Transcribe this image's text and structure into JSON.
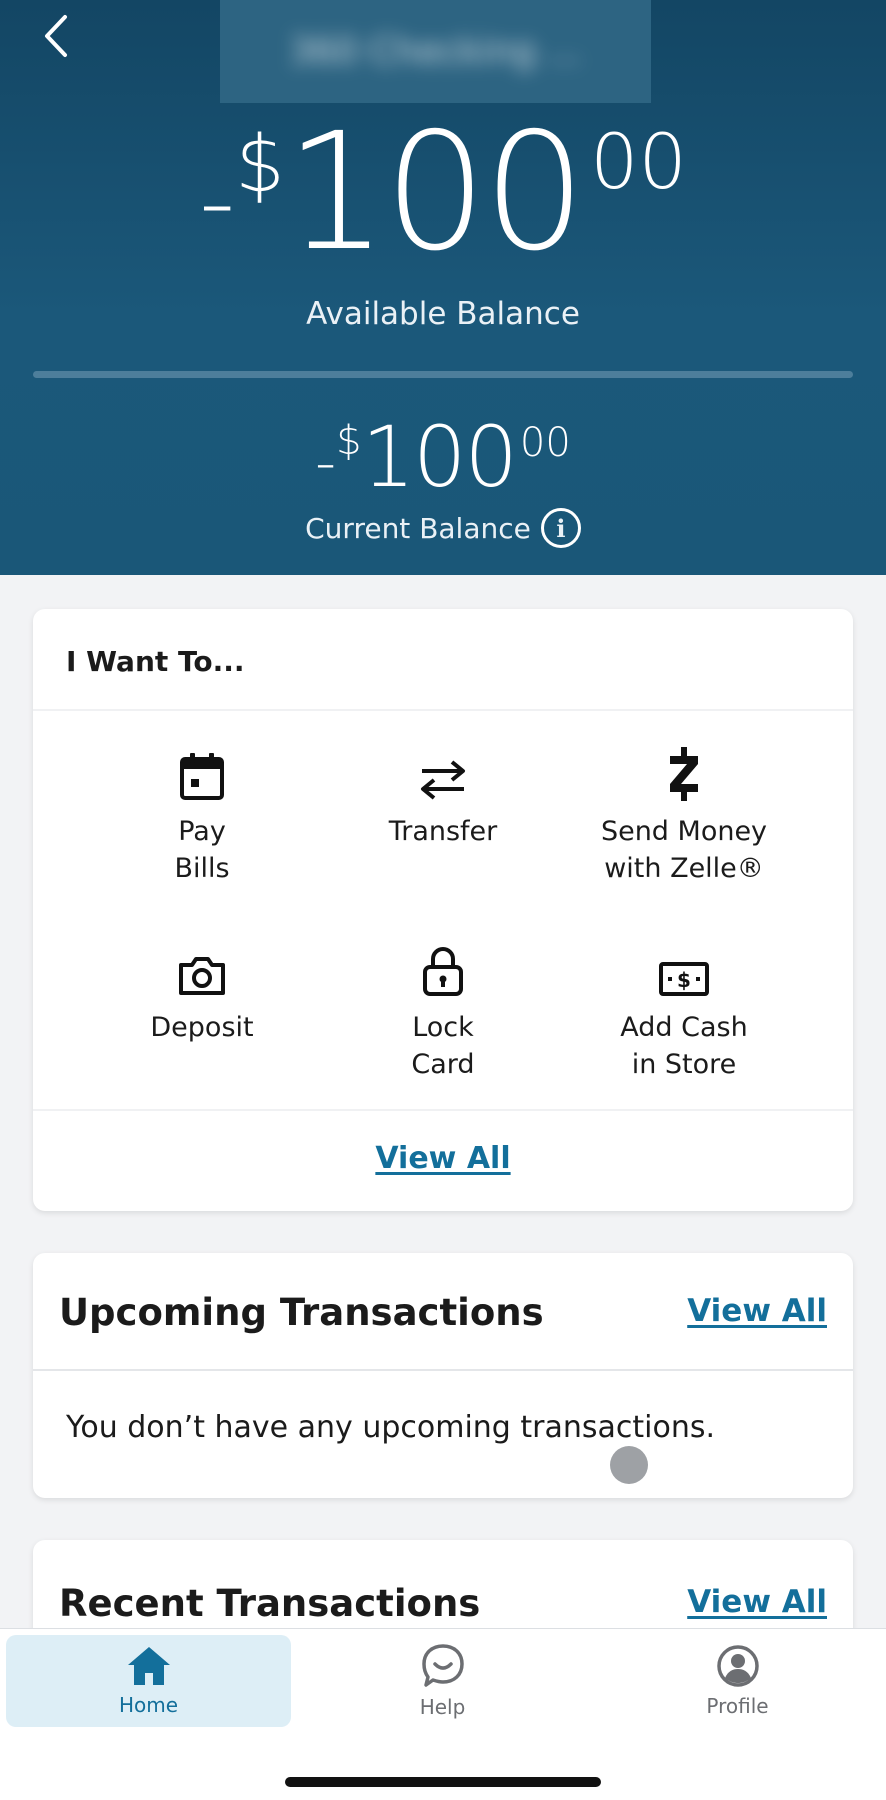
{
  "header": {
    "account_name": "360 Checking ...",
    "available_balance": {
      "sign": "-",
      "currency": "$",
      "dollars": "100",
      "cents": "00"
    },
    "available_label": "Available Balance",
    "current_balance": {
      "sign": "-",
      "currency": "$",
      "dollars": "100",
      "cents": "00"
    },
    "current_label": "Current Balance",
    "info_glyph": "i"
  },
  "want_to": {
    "title": "I Want To...",
    "actions": [
      {
        "label": "Pay\nBills",
        "icon": "calendar-icon"
      },
      {
        "label": "Transfer",
        "icon": "transfer-arrows-icon"
      },
      {
        "label": "Send Money\nwith Zelle®",
        "icon": "zelle-icon"
      },
      {
        "label": "Deposit",
        "icon": "camera-icon"
      },
      {
        "label": "Lock\nCard",
        "icon": "lock-icon"
      },
      {
        "label": "Add Cash\nin Store",
        "icon": "cash-icon"
      }
    ],
    "view_all": "View All"
  },
  "upcoming": {
    "title": "Upcoming Transactions",
    "view_all": "View All",
    "empty_message": "You don’t have any upcoming transactions."
  },
  "recent": {
    "title": "Recent Transactions",
    "view_all": "View All"
  },
  "nav": {
    "items": [
      {
        "label": "Home",
        "icon": "home-icon",
        "active": true
      },
      {
        "label": "Help",
        "icon": "chat-bubble-icon",
        "active": false
      },
      {
        "label": "Profile",
        "icon": "profile-icon",
        "active": false
      }
    ]
  },
  "colors": {
    "header_bg": "#1a5778",
    "link": "#136f9b",
    "nav_active_bg": "#ddeef6"
  }
}
